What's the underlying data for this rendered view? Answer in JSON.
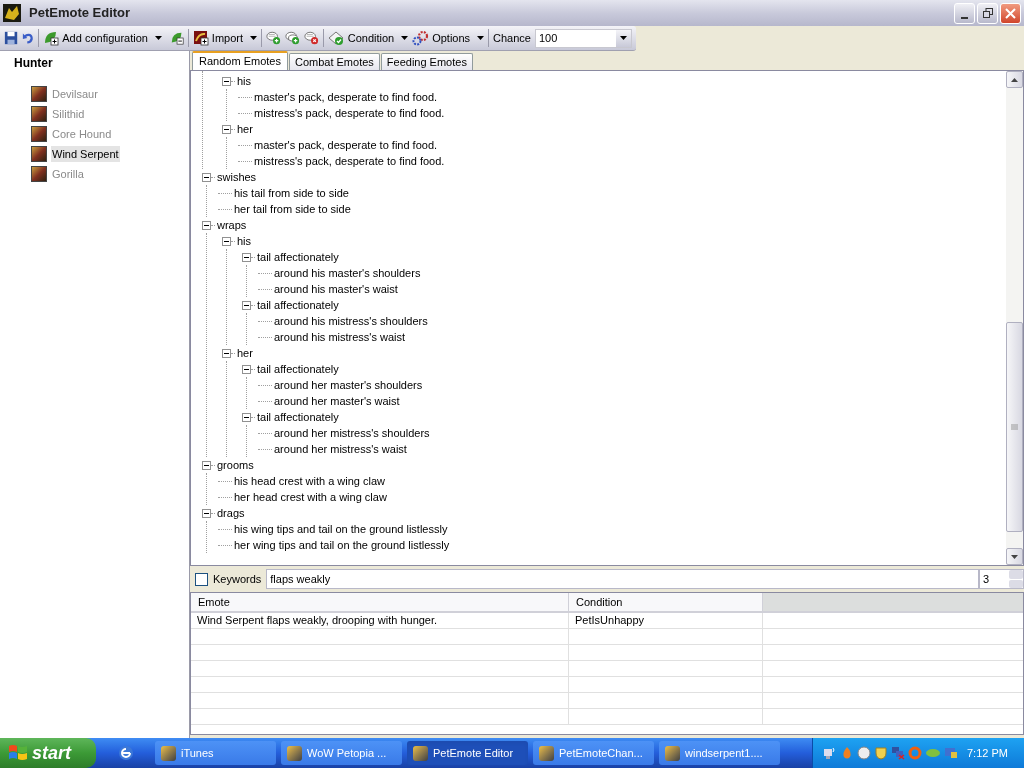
{
  "window": {
    "title": "PetEmote Editor"
  },
  "toolbar": {
    "add_configuration": "Add configuration",
    "import": "Import",
    "condition": "Condition",
    "options": "Options",
    "chance_label": "Chance",
    "chance_value": "100"
  },
  "sidebar": {
    "heading": "Hunter",
    "items": [
      {
        "label": "Devilsaur",
        "selected": false
      },
      {
        "label": "Silithid",
        "selected": false
      },
      {
        "label": "Core Hound",
        "selected": false
      },
      {
        "label": "Wind Serpent",
        "selected": true
      },
      {
        "label": "Gorilla",
        "selected": false
      }
    ]
  },
  "tabs": [
    {
      "label": "Random Emotes",
      "selected": true
    },
    {
      "label": "Combat Emotes",
      "selected": false
    },
    {
      "label": "Feeding Emotes",
      "selected": false
    }
  ],
  "tree": [
    {
      "children": [
        {
          "label": "his",
          "expanded": true,
          "children": [
            {
              "label": "master's pack, desperate to find food."
            },
            {
              "label": "mistress's pack, desperate to find food."
            }
          ]
        },
        {
          "label": "her",
          "expanded": true,
          "children": [
            {
              "label": "master's pack, desperate to find food."
            },
            {
              "label": "mistress's pack, desperate to find food."
            }
          ]
        }
      ]
    },
    {
      "label": "swishes",
      "expanded": true,
      "children": [
        {
          "label": "his tail from side to side"
        },
        {
          "label": "her tail from side to side"
        }
      ]
    },
    {
      "label": "wraps",
      "expanded": true,
      "children": [
        {
          "label": "his",
          "expanded": true,
          "children": [
            {
              "label": "tail affectionately",
              "expanded": true,
              "children": [
                {
                  "label": "around his master's shoulders"
                },
                {
                  "label": "around his master's waist"
                }
              ]
            },
            {
              "label": "tail affectionately",
              "expanded": true,
              "children": [
                {
                  "label": "around his mistress's shoulders"
                },
                {
                  "label": "around his mistress's waist"
                }
              ]
            }
          ]
        },
        {
          "label": "her",
          "expanded": true,
          "children": [
            {
              "label": "tail affectionately",
              "expanded": true,
              "children": [
                {
                  "label": "around her master's shoulders"
                },
                {
                  "label": "around her master's waist"
                }
              ]
            },
            {
              "label": "tail affectionately",
              "expanded": true,
              "children": [
                {
                  "label": "around her mistress's shoulders"
                },
                {
                  "label": "around her mistress's waist"
                }
              ]
            }
          ]
        }
      ]
    },
    {
      "label": "grooms",
      "expanded": true,
      "children": [
        {
          "label": "his head crest with a wing claw"
        },
        {
          "label": "her head crest with a wing claw"
        }
      ]
    },
    {
      "label": "drags",
      "expanded": true,
      "children": [
        {
          "label": "his wing tips and tail on the ground listlessly"
        },
        {
          "label": "her wing tips and tail on the ground listlessly"
        }
      ]
    }
  ],
  "keywords": {
    "label": "Keywords",
    "checked": false,
    "value": "flaps weakly",
    "count": "3"
  },
  "table": {
    "columns": [
      "Emote",
      "Condition"
    ],
    "rows": [
      [
        "Wind Serpent flaps weakly, drooping with hunger.",
        "PetIsUnhappy"
      ]
    ]
  },
  "taskbar": {
    "start": "start",
    "tasks": [
      {
        "label": "iTunes",
        "selected": false
      },
      {
        "label": "WoW Petopia ...",
        "selected": false
      },
      {
        "label": "PetEmote Editor",
        "selected": true
      },
      {
        "label": "PetEmoteChan...",
        "selected": false
      },
      {
        "label": "windserpent1....",
        "selected": false
      }
    ],
    "clock": "7:12 PM"
  }
}
